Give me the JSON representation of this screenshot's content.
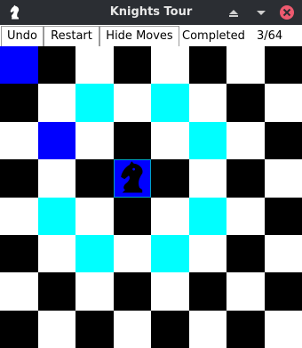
{
  "window": {
    "title": "Knights Tour"
  },
  "toolbar": {
    "undo_label": "Undo",
    "restart_label": "Restart",
    "hide_moves_label": "Hide Moves",
    "completed_label": "Completed",
    "completed_value": "3/64"
  },
  "board": {
    "rows": 8,
    "cols": 8,
    "visited": [
      [
        0,
        0
      ],
      [
        2,
        1
      ],
      [
        3,
        3
      ]
    ],
    "knight": [
      3,
      3
    ],
    "possible_moves": [
      [
        1,
        2
      ],
      [
        1,
        4
      ],
      [
        2,
        5
      ],
      [
        4,
        1
      ],
      [
        4,
        5
      ],
      [
        5,
        2
      ],
      [
        5,
        4
      ]
    ],
    "colors": {
      "light": "#ffffff",
      "dark": "#000000",
      "visited": "#0000ff",
      "move_hint": "#00ffff",
      "knight_outline": "#00a0c8"
    },
    "knight_icon": "knight-chess-icon"
  }
}
